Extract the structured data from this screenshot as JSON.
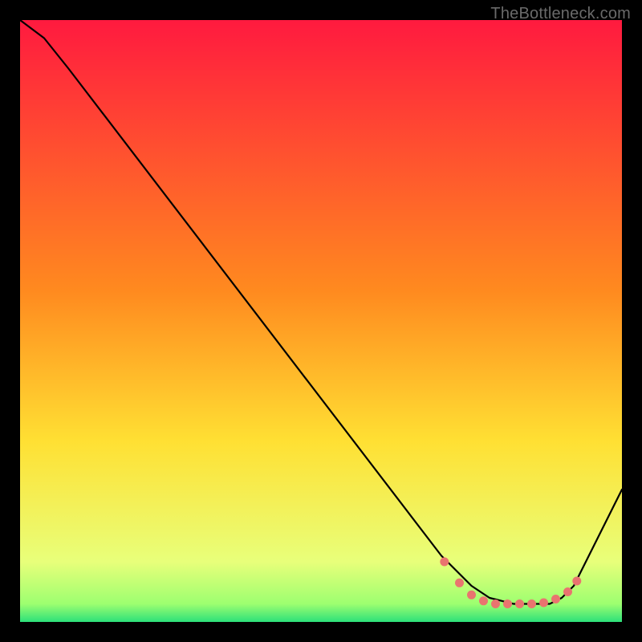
{
  "credit": "TheBottleneck.com",
  "colors": {
    "black": "#000000",
    "curve": "#000000",
    "dots": "#e9746f",
    "grad_top": "#ff1a3f",
    "grad_mid": "#ffd400",
    "grad_green_light": "#d6ff70",
    "grad_green": "#2de07a"
  },
  "chart_data": {
    "type": "line",
    "title": "",
    "xlabel": "",
    "ylabel": "",
    "xlim": [
      0,
      100
    ],
    "ylim": [
      0,
      100
    ],
    "grid": false,
    "series": [
      {
        "name": "bottleneck-curve",
        "x": [
          0,
          4,
          8,
          70,
          75,
          78,
          82,
          85,
          88,
          90,
          92,
          100
        ],
        "y": [
          100,
          97,
          92,
          11,
          6,
          4,
          3,
          3,
          3,
          4,
          6,
          22
        ]
      }
    ],
    "points": {
      "name": "flat-region-dots",
      "x": [
        70.5,
        73,
        75,
        77,
        79,
        81,
        83,
        85,
        87,
        89,
        91,
        92.5
      ],
      "y": [
        10,
        6.5,
        4.5,
        3.5,
        3,
        3,
        3,
        3,
        3.2,
        3.8,
        5,
        6.8
      ]
    }
  }
}
